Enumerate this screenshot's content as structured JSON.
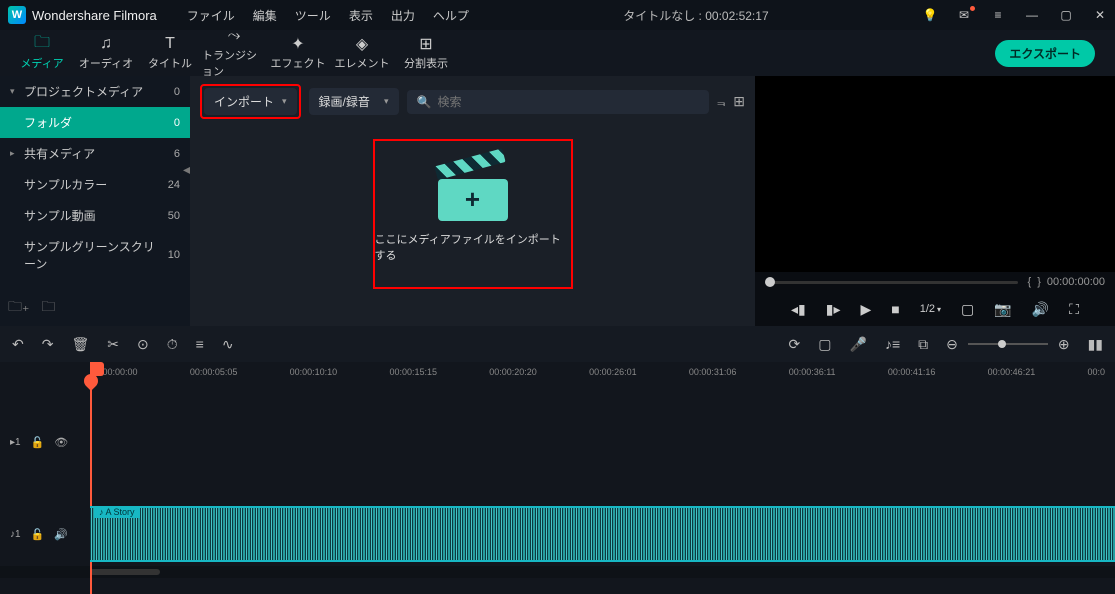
{
  "app": {
    "name": "Wondershare Filmora"
  },
  "menu": {
    "items": [
      "ファイル",
      "編集",
      "ツール",
      "表示",
      "出力",
      "ヘルプ"
    ]
  },
  "doc": {
    "title": "タイトルなし : 00:02:52:17"
  },
  "tabs": {
    "items": [
      {
        "label": "メディア",
        "icon": "folder-icon",
        "active": true
      },
      {
        "label": "オーディオ",
        "icon": "music-icon"
      },
      {
        "label": "タイトル",
        "icon": "text-icon"
      },
      {
        "label": "トランジション",
        "icon": "transition-icon"
      },
      {
        "label": "エフェクト",
        "icon": "effects-icon"
      },
      {
        "label": "エレメント",
        "icon": "elements-icon"
      },
      {
        "label": "分割表示",
        "icon": "split-icon"
      }
    ],
    "export_label": "エクスポート"
  },
  "sidebar": {
    "items": [
      {
        "label": "プロジェクトメディア",
        "count": "0",
        "caret": "▾"
      },
      {
        "label": "フォルダ",
        "count": "0",
        "selected": true
      },
      {
        "label": "共有メディア",
        "count": "6",
        "caret": "▸"
      },
      {
        "label": "サンプルカラー",
        "count": "24"
      },
      {
        "label": "サンプル動画",
        "count": "50"
      },
      {
        "label": "サンプルグリーンスクリーン",
        "count": "10"
      }
    ]
  },
  "content": {
    "import_label": "インポート",
    "record_label": "録画/録音",
    "search_placeholder": "検索",
    "drop_text": "ここにメディアファイルをインポートする"
  },
  "preview": {
    "time_bracket_l": "{",
    "time_bracket_r": "}",
    "time": "00:00:00:00",
    "ratio": "1/2"
  },
  "ruler": {
    "marks": [
      "00:00:00:00",
      "00:00:05:05",
      "00:00:10:10",
      "00:00:15:15",
      "00:00:20:20",
      "00:00:26:01",
      "00:00:31:06",
      "00:00:36:11",
      "00:00:41:16",
      "00:00:46:21",
      "00:0"
    ]
  },
  "tracks": {
    "video": {
      "label": "▸1"
    },
    "audio": {
      "label": "♪1",
      "clip_name": "A Story"
    }
  }
}
